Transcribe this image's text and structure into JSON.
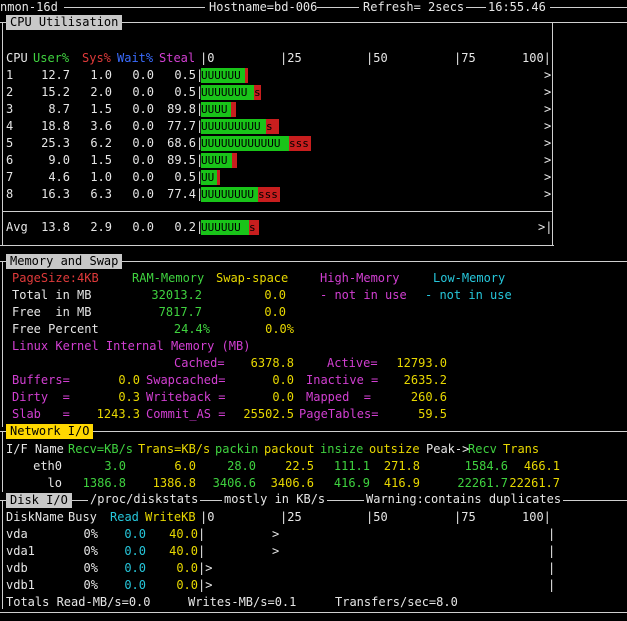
{
  "top_line": {
    "version": "nmon-16d",
    "hostname": "Hostname=bd-006",
    "refresh": "Refresh= 2secs",
    "time": "16:55.46"
  },
  "cpu": {
    "section_title": "CPU Utilisation",
    "headers": {
      "cpu": "CPU",
      "user": "User%",
      "sys": "Sys%",
      "wait": "Wait%",
      "steal": "Steal"
    },
    "scale": [
      "|0",
      "|25",
      "|50",
      "|75",
      "100|"
    ],
    "rows": [
      {
        "id": "1",
        "user": "12.7",
        "sys": "1.0",
        "wait": "0.0",
        "steal": "0.5",
        "u": 12.7,
        "s": 1.0,
        "bar": "UUUUUU",
        "end": ">"
      },
      {
        "id": "2",
        "user": "15.2",
        "sys": "2.0",
        "wait": "0.0",
        "steal": "0.5",
        "u": 15.2,
        "s": 2.0,
        "bar": "UUUUUUUs",
        "end": ">"
      },
      {
        "id": "3",
        "user": "8.7",
        "sys": "1.5",
        "wait": "0.0",
        "steal": "89.8",
        "u": 8.7,
        "s": 1.5,
        "bar": "UUUU",
        "end": ">"
      },
      {
        "id": "4",
        "user": "18.8",
        "sys": "3.6",
        "wait": "0.0",
        "steal": "77.7",
        "u": 18.8,
        "s": 3.6,
        "bar": "UUUUUUUUUs",
        "end": ">"
      },
      {
        "id": "5",
        "user": "25.3",
        "sys": "6.2",
        "wait": "0.0",
        "steal": "68.6",
        "u": 25.3,
        "s": 6.2,
        "bar": "UUUUUUUUUUUUsss",
        "end": ">"
      },
      {
        "id": "6",
        "user": "9.0",
        "sys": "1.5",
        "wait": "0.0",
        "steal": "89.5",
        "u": 9.0,
        "s": 1.5,
        "bar": "UUUU",
        "end": ">"
      },
      {
        "id": "7",
        "user": "4.6",
        "sys": "1.0",
        "wait": "0.0",
        "steal": "0.5",
        "u": 4.6,
        "s": 1.0,
        "bar": "UU",
        "end": ">"
      },
      {
        "id": "8",
        "user": "16.3",
        "sys": "6.3",
        "wait": "0.0",
        "steal": "77.4",
        "u": 16.3,
        "s": 6.3,
        "bar": "UUUUUUUUsss",
        "end": ">"
      }
    ],
    "avg": {
      "label": "Avg",
      "user": "13.8",
      "sys": "2.9",
      "wait": "0.0",
      "steal": "0.2",
      "u": 13.8,
      "s": 2.9,
      "bar": "UUUUUUs",
      "end": ">|"
    }
  },
  "mem": {
    "section_title": "Memory and Swap",
    "page_size": "PageSize:4KB",
    "col_ram": "RAM-Memory",
    "col_swap": "Swap-space",
    "col_high": "High-Memory",
    "col_low": "Low-Memory",
    "total_label": "Total in MB",
    "total_ram": "32013.2",
    "total_swap": "0.0",
    "high_status": "- not in use",
    "low_status": "- not in use",
    "free_label": "Free  in MB",
    "free_ram": "7817.7",
    "free_swap": "0.0",
    "pct_label": "Free Percent",
    "pct_ram": "24.4%",
    "pct_swap": "0.0%",
    "kernel_title": "Linux Kernel Internal Memory (MB)",
    "cached_label": "Cached=",
    "cached": "6378.8",
    "active_label": "Active=",
    "active": "12793.0",
    "buffers_label": "Buffers=",
    "buffers": "0.0",
    "swapcached_label": "Swapcached=",
    "swapcached": "0.0",
    "inactive_label": "Inactive =",
    "inactive": "2635.2",
    "dirty_label": "Dirty  =",
    "dirty": "0.3",
    "writeback_label": "Writeback =",
    "writeback": "0.0",
    "mapped_label": "Mapped  =",
    "mapped": "260.6",
    "slab_label": "Slab   =",
    "slab": "1243.3",
    "commit_label": "Commit_AS =",
    "commit": "25502.5",
    "pagetables_label": "PageTables=",
    "pagetables": "59.5"
  },
  "net": {
    "section_title": "Network I/O",
    "h_ifname": "I/F Name",
    "h_recv": "Recv=KB/s",
    "h_trans": "Trans=KB/s",
    "h_packin": "packin",
    "h_packout": "packout",
    "h_insize": "insize",
    "h_outsize": "outsize",
    "h_peak": "Peak->",
    "h_peak_recv": "Recv",
    "h_peak_trans": "Trans",
    "rows": [
      {
        "name": "eth0",
        "recv": "3.0",
        "trans": "6.0",
        "packin": "28.0",
        "packout": "22.5",
        "insize": "111.1",
        "outsize": "271.8",
        "peak_recv": "1584.6",
        "peak_trans": "466.1"
      },
      {
        "name": "lo",
        "recv": "1386.8",
        "trans": "1386.8",
        "packin": "3406.6",
        "packout": "3406.6",
        "insize": "416.9",
        "outsize": "416.9",
        "peak_recv": "22261.7",
        "peak_trans": "22261.7"
      }
    ]
  },
  "disk": {
    "section_title": "Disk I/O",
    "title_rest": "/proc/diskstats",
    "mostly": "mostly in KB/s",
    "warning": "Warning:contains duplicates",
    "h_name": "DiskName",
    "h_busy": "Busy",
    "h_read": "Read",
    "h_write": "WriteKB",
    "scale": [
      "|0",
      "|25",
      "|50",
      "|75",
      "100|"
    ],
    "rows": [
      {
        "name": "vda",
        "busy": "0%",
        "read": "0.0",
        "write": "40.0",
        "mark": "|",
        "arrow": ">",
        "end": "|"
      },
      {
        "name": "vda1",
        "busy": "0%",
        "read": "0.0",
        "write": "40.0",
        "mark": "|",
        "arrow": ">",
        "end": "|"
      },
      {
        "name": "vdb",
        "busy": "0%",
        "read": "0.0",
        "write": "0.0",
        "mark": "|>",
        "arrow": "",
        "end": "|"
      },
      {
        "name": "vdb1",
        "busy": "0%",
        "read": "0.0",
        "write": "0.0",
        "mark": "|>",
        "arrow": "",
        "end": "|"
      }
    ],
    "totals_read": "Totals Read-MB/s=0.0",
    "totals_write": "Writes-MB/s=0.1",
    "totals_transfers": "Transfers/sec=8.0"
  }
}
